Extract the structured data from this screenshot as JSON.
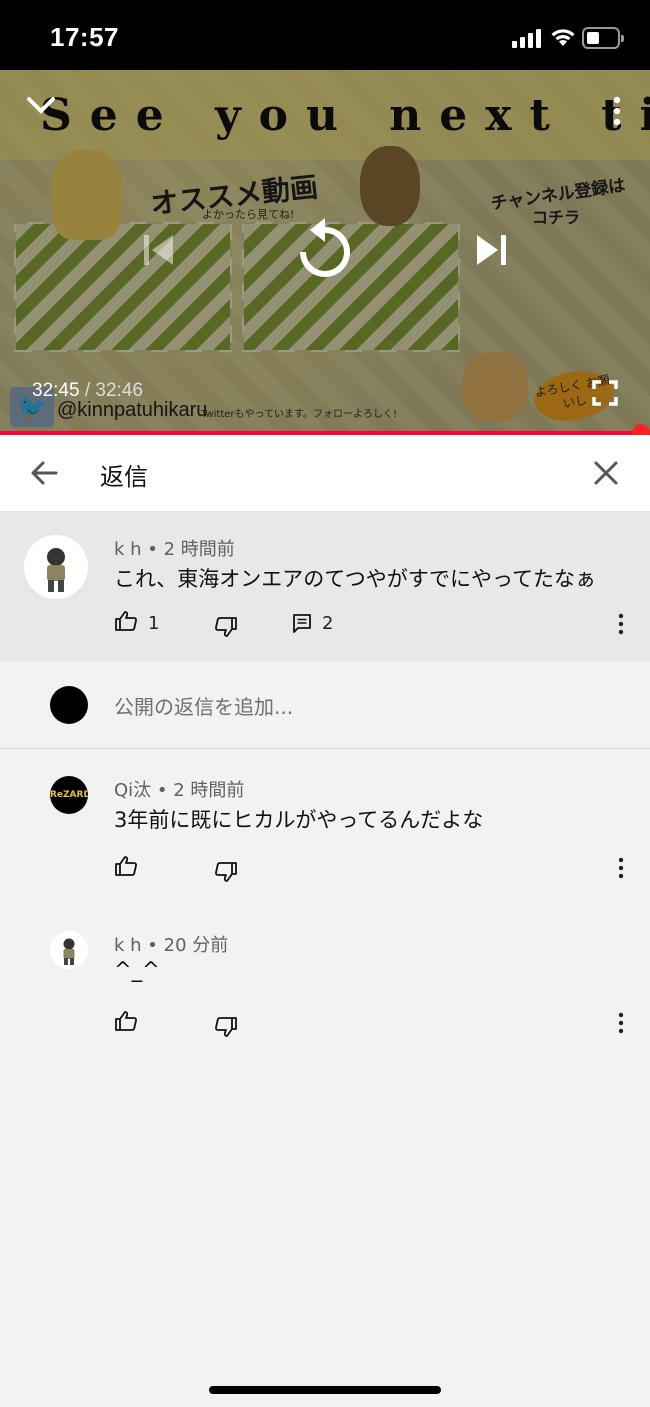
{
  "status_bar": {
    "time": "17:57"
  },
  "video": {
    "banner_text": "See you next time!",
    "osusume_label": "オススメ動画",
    "osusume_sub": "よかったら見てね!",
    "channel_label": "チャンネル登録は",
    "channel_label2": "コチラ",
    "twitter_handle": "@kinnpatuhikaru",
    "twitter_sub": "Twitterもやっています。フォローよろしく!",
    "yoroshiku": "よろしく お願いし",
    "current_time": "32:45",
    "separator": " / ",
    "duration": "32:46",
    "progress": 0.9995
  },
  "replies_header": {
    "title": "返信"
  },
  "parent_comment": {
    "author": "k h",
    "age": "2 時間前",
    "text": "これ、東海オンエアのてつやがすでにやってたなぁ",
    "likes": "1",
    "replies": "2"
  },
  "add_reply": {
    "placeholder": "公開の返信を追加..."
  },
  "replies": [
    {
      "author": "Qi汰",
      "age": "2 時間前",
      "text": "3年前に既にヒカルがやってるんだよな",
      "avatar_text": "ReZARD"
    },
    {
      "author": "k h",
      "age": "20 分前",
      "text": "^_^"
    }
  ],
  "colors": {
    "progress": "#ff0033",
    "header_bg": "#ffffff",
    "page_bg": "#f2f2f2",
    "parent_bg": "#e8e8e8"
  }
}
